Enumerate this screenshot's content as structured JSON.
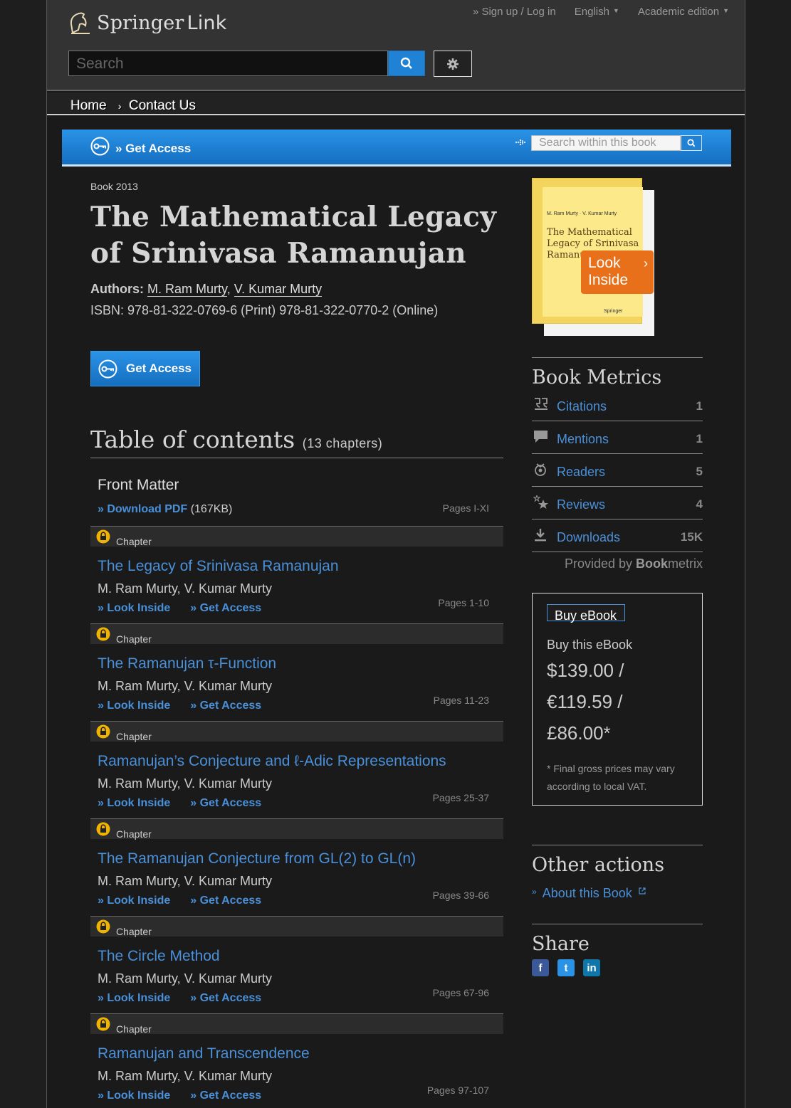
{
  "header": {
    "logo_brand": "Springer",
    "logo_suffix": "Link",
    "signup": "» Sign up / Log in",
    "language": "English",
    "edition": "Academic edition",
    "search_placeholder": "Search"
  },
  "nav": {
    "home": "Home",
    "separator": "›",
    "contact": "Contact Us"
  },
  "access_bar": {
    "label": "» Get Access",
    "search_placeholder": "Search within this book"
  },
  "book": {
    "type": "Book 2013",
    "title": "The Mathematical Legacy of Srinivasa Ramanujan",
    "authors_label": "Authors:",
    "author1": "M. Ram Murty",
    "author_sep": ",",
    "author2": "V. Kumar Murty",
    "isbn": "ISBN: 978-81-322-0769-6 (Print) 978-81-322-0770-2 (Online)",
    "get_access": "Get Access"
  },
  "toc": {
    "title": "Table of contents",
    "count": "(13 chapters)",
    "front_matter": {
      "title": "Front Matter",
      "download": "» Download PDF",
      "size": "(167KB)",
      "pages": "Pages I-XI"
    },
    "chapters": [
      {
        "type": "Chapter",
        "title": "The Legacy of Srinivasa Ramanujan",
        "authors": "M. Ram Murty, V. Kumar Murty",
        "look": "» Look Inside",
        "access": "» Get Access",
        "pages": "Pages 1-10"
      },
      {
        "type": "Chapter",
        "title": "The Ramanujan τ-Function",
        "authors": "M. Ram Murty, V. Kumar Murty",
        "look": "» Look Inside",
        "access": "» Get Access",
        "pages": "Pages 11-23"
      },
      {
        "type": "Chapter",
        "title": "Ramanujan’s Conjecture and ℓ-Adic Representations",
        "authors": "M. Ram Murty, V. Kumar Murty",
        "look": "» Look Inside",
        "access": "» Get Access",
        "pages": "Pages 25-37"
      },
      {
        "type": "Chapter",
        "title": "The Ramanujan Conjecture from GL(2) to GL(n)",
        "authors": "M. Ram Murty, V. Kumar Murty",
        "look": "» Look Inside",
        "access": "» Get Access",
        "pages": "Pages 39-66"
      },
      {
        "type": "Chapter",
        "title": "The Circle Method",
        "authors": "M. Ram Murty, V. Kumar Murty",
        "look": "» Look Inside",
        "access": "» Get Access",
        "pages": "Pages 67-96"
      },
      {
        "type": "Chapter",
        "title": "Ramanujan and Transcendence",
        "authors": "M. Ram Murty, V. Kumar Murty",
        "look": "» Look Inside",
        "access": "» Get Access",
        "pages": "Pages 97-107"
      }
    ]
  },
  "cover": {
    "authors": "M. Ram Murty · V. Kumar Murty",
    "title": "The Mathematical Legacy of Srinivasa Ramanujan",
    "publisher": "Springer",
    "look_line1": "Look",
    "look_line2": "Inside"
  },
  "metrics": {
    "title": "Book Metrics",
    "rows": [
      {
        "label": "Citations",
        "value": "1",
        "icon": "quote-icon"
      },
      {
        "label": "Mentions",
        "value": "1",
        "icon": "speech-bubble-icon"
      },
      {
        "label": "Readers",
        "value": "5",
        "icon": "readers-icon"
      },
      {
        "label": "Reviews",
        "value": "4",
        "icon": "stars-icon"
      },
      {
        "label": "Downloads",
        "value": "15K",
        "icon": "download-icon"
      }
    ],
    "provided_prefix": "Provided by ",
    "provided_bold": "Book",
    "provided_suffix": "metrix"
  },
  "buy": {
    "tab": "Buy eBook",
    "label": "Buy this eBook",
    "price_usd": "$139.00 /",
    "price_eur": "€119.59 /",
    "price_gbp": "£86.00*",
    "vat": "* Final gross prices may vary according to local VAT."
  },
  "other_actions": {
    "title": "Other actions",
    "about": "About this Book"
  },
  "share": {
    "title": "Share",
    "facebook": "f",
    "twitter": "t",
    "linkedin": "in"
  },
  "colors": {
    "accent": "#1f82d4",
    "link": "#4a90d9",
    "orange": "#e8701a"
  }
}
